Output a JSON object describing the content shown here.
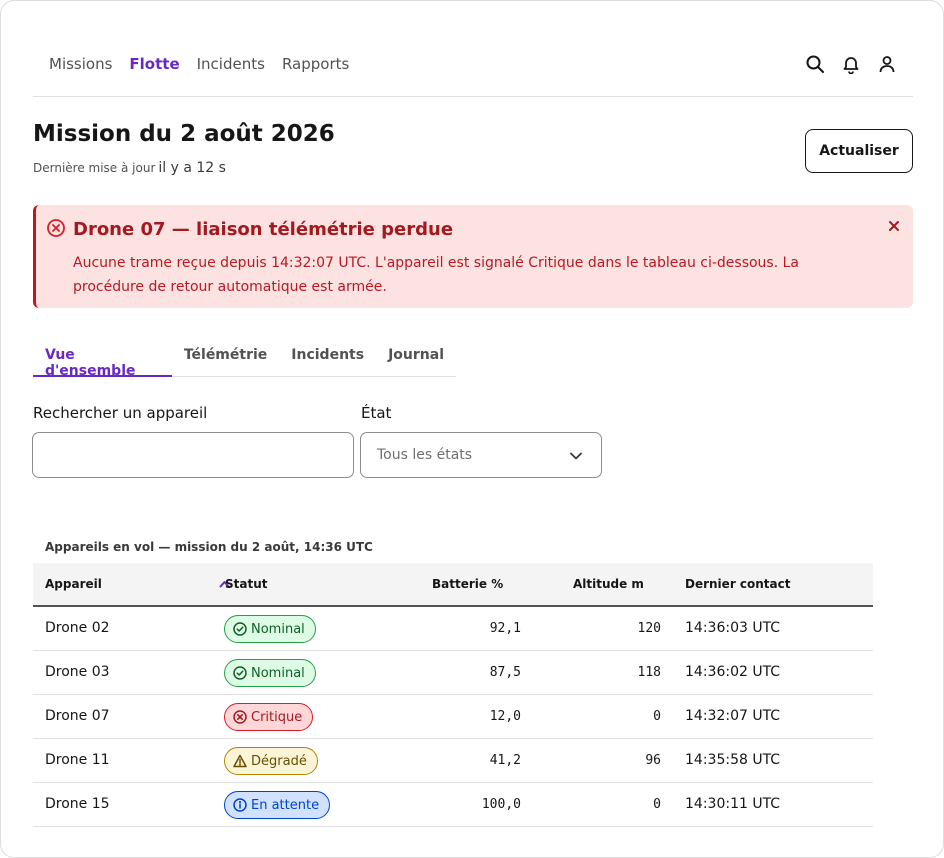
{
  "nav": {
    "links": [
      {
        "label": "Missions"
      },
      {
        "label": "Flotte"
      },
      {
        "label": "Incidents"
      },
      {
        "label": "Rapports"
      }
    ],
    "active": "Flotte",
    "icons": [
      "search-icon",
      "bell-icon",
      "user-icon"
    ]
  },
  "header": {
    "title": "Mission du 2 août 2026",
    "updated_label": "Dernière mise à jour",
    "updated_value": "il y a 12 s",
    "refresh_label": "Actualiser"
  },
  "alert": {
    "icon": "error-icon",
    "title": "Drone 07 — liaison télémétrie perdue",
    "body": "Aucune trame reçue depuis 14:32:07 UTC. L'appareil est signalé Critique dans le tableau ci-dessous. La procédure de retour automatique est armée.",
    "color": "#da1e28"
  },
  "tabs": [
    {
      "label": "Vue d'ensemble"
    },
    {
      "label": "Télémétrie"
    },
    {
      "label": "Incidents"
    },
    {
      "label": "Journal"
    }
  ],
  "filters": {
    "search_label": "Rechercher un appareil",
    "search_value": "",
    "state_label": "État",
    "state_value": "Tous les états"
  },
  "table": {
    "caption": "Appareils en vol — mission du 2 août, 14:36 UTC",
    "columns": [
      "Appareil",
      "Statut",
      "Batterie %",
      "Altitude m",
      "Dernier contact"
    ],
    "sort": {
      "column": "Appareil",
      "direction": "ascending"
    },
    "rows": [
      {
        "device": "Drone 02",
        "status": "Nominal",
        "kind": "ok",
        "battery": "92,1",
        "altitude": "120",
        "contact": "14:36:03 UTC"
      },
      {
        "device": "Drone 03",
        "status": "Nominal",
        "kind": "ok",
        "battery": "87,5",
        "altitude": "118",
        "contact": "14:36:02 UTC"
      },
      {
        "device": "Drone 07",
        "status": "Critique",
        "kind": "crit",
        "battery": "12,0",
        "altitude": "0",
        "contact": "14:32:07 UTC"
      },
      {
        "device": "Drone 11",
        "status": "Dégradé",
        "kind": "warn",
        "battery": "41,2",
        "altitude": "96",
        "contact": "14:35:58 UTC"
      },
      {
        "device": "Drone 15",
        "status": "En attente",
        "kind": "info",
        "battery": "100,0",
        "altitude": "0",
        "contact": "14:30:11 UTC"
      }
    ]
  },
  "colors": {
    "accent": "#6929c4",
    "nominal": "#24a148",
    "critical": "#da1e28",
    "degraded": "#f1c21b",
    "pending": "#0043ce"
  }
}
